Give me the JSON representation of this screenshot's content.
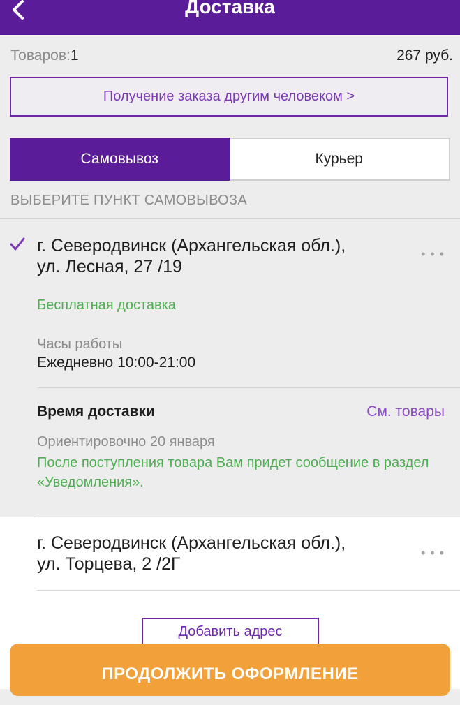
{
  "header": {
    "title": "Доставка",
    "back_icon": "chevron-left-icon"
  },
  "summary": {
    "items_label": "Товаров:",
    "items_count": "1",
    "total": "267 руб."
  },
  "other_person_link": "Получение заказа другим человеком >",
  "delivery_tabs": [
    {
      "label": "Самовывоз",
      "active": true
    },
    {
      "label": "Курьер",
      "active": false
    }
  ],
  "pickup_section_title": "ВЫБЕРИТЕ ПУНКТ САМОВЫВОЗА",
  "pickup_points": [
    {
      "selected": true,
      "address_line1": "г. Северодвинск (Архангельская обл.),",
      "address_line2": "ул. Лесная, 27 /19",
      "more_label": "• • •",
      "delivery_cost": "Бесплатная доставка",
      "hours_label": "Часы работы",
      "hours_value": "Ежедневно 10:00-21:00",
      "delivery_time_title": "Время доставки",
      "see_goods_link": "См. товары",
      "approx_date": "Ориентировочно 20 января",
      "notice": "После поступления товара Вам придет сообщение в раздел «Уведомления»."
    },
    {
      "selected": false,
      "address_line1": "г. Северодвинск (Архангельская обл.),",
      "address_line2": "ул. Торцева, 2 /2Г",
      "more_label": "• • •"
    }
  ],
  "add_address_button": "Добавить адрес",
  "continue_button": "ПРОДОЛЖИТЬ ОФОРМЛЕНИЕ",
  "colors": {
    "brand_purple": "#5b1c99",
    "link_purple": "#7a3bb4",
    "green": "#4caf50",
    "cta_orange": "#f2a13a"
  }
}
